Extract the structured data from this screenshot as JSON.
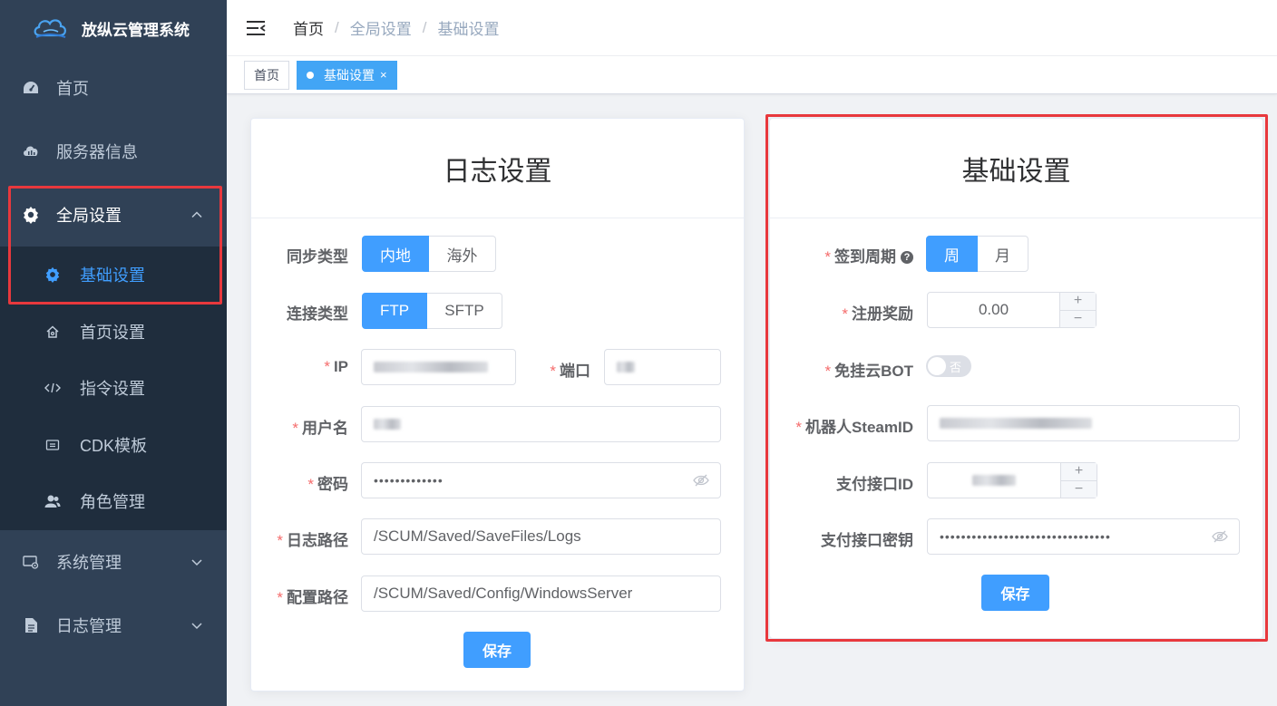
{
  "app": {
    "title": "放纵云管理系统"
  },
  "sidebar": {
    "items": [
      {
        "label": "首页"
      },
      {
        "label": "服务器信息"
      },
      {
        "label": "全局设置"
      },
      {
        "label": "系统管理"
      },
      {
        "label": "日志管理"
      }
    ],
    "sub_items": [
      {
        "label": "基础设置"
      },
      {
        "label": "首页设置"
      },
      {
        "label": "指令设置"
      },
      {
        "label": "CDK模板"
      },
      {
        "label": "角色管理"
      }
    ]
  },
  "breadcrumb": [
    "首页",
    "全局设置",
    "基础设置"
  ],
  "tags": [
    {
      "label": "首页"
    },
    {
      "label": "基础设置",
      "close": "×"
    }
  ],
  "log_settings": {
    "title": "日志设置",
    "sync_type": {
      "label": "同步类型",
      "options": [
        "内地",
        "海外"
      ],
      "selected": "内地"
    },
    "conn_type": {
      "label": "连接类型",
      "options": [
        "FTP",
        "SFTP"
      ],
      "selected": "FTP"
    },
    "ip": {
      "label": "IP"
    },
    "port": {
      "label": "端口"
    },
    "username": {
      "label": "用户名"
    },
    "password": {
      "label": "密码",
      "value": "•••••••••••••"
    },
    "log_path": {
      "label": "日志路径",
      "value": "/SCUM/Saved/SaveFiles/Logs"
    },
    "config_path": {
      "label": "配置路径",
      "value": "/SCUM/Saved/Config/WindowsServer"
    },
    "save": "保存"
  },
  "basic_settings": {
    "title": "基础设置",
    "signin_cycle": {
      "label": "签到周期",
      "help": "?",
      "options": [
        "周",
        "月"
      ],
      "selected": "周"
    },
    "register_reward": {
      "label": "注册奖励",
      "value": "0.00"
    },
    "free_bot": {
      "label": "免挂云BOT",
      "state": "否",
      "on": false
    },
    "steam_id": {
      "label": "机器人SteamID"
    },
    "pay_id": {
      "label": "支付接口ID"
    },
    "pay_key": {
      "label": "支付接口密钥",
      "value": "••••••••••••••••••••••••••••••••"
    },
    "save": "保存"
  },
  "colors": {
    "sidebar_bg": "#304156",
    "submenu_bg": "#1f2d3d",
    "primary": "#409eff",
    "highlight_box": "#e8383d"
  },
  "stepper": {
    "plus": "+",
    "minus": "−"
  },
  "required_mark": "*"
}
